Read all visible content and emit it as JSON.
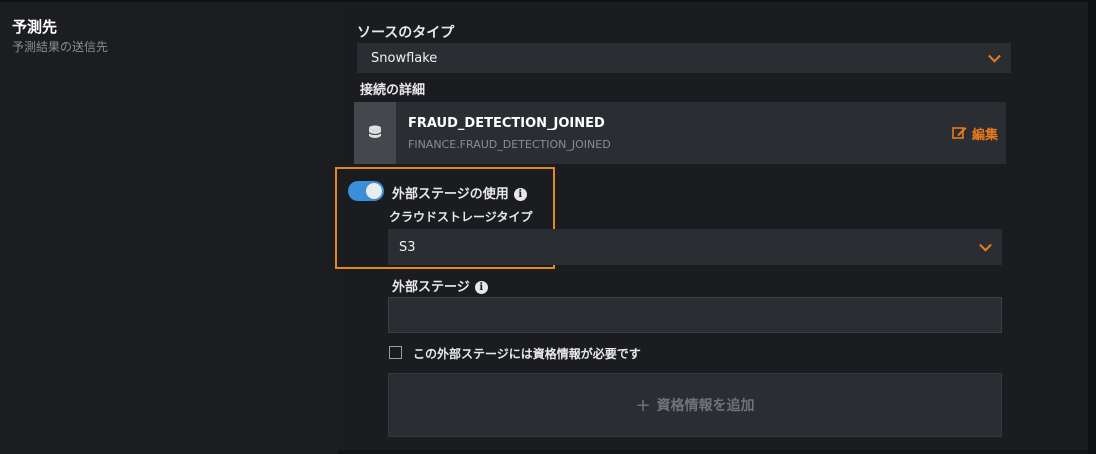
{
  "section": {
    "title": "予測先",
    "subtitle": "予測結果の送信先"
  },
  "source_type": {
    "label": "ソースのタイプ",
    "value": "Snowflake"
  },
  "connection": {
    "label": "接続の詳細",
    "name": "FRAUD_DETECTION_JOINED",
    "path": "FINANCE.FRAUD_DETECTION_JOINED",
    "edit_label": "編集"
  },
  "external_stage_toggle": {
    "label": "外部ステージの使用",
    "enabled": true
  },
  "cloud_storage": {
    "label": "クラウドストレージタイプ",
    "value": "S3"
  },
  "external_stage": {
    "label": "外部ステージ",
    "value": ""
  },
  "credentials_checkbox": {
    "label": "この外部ステージには資格情報が必要です",
    "checked": false
  },
  "add_credentials": {
    "plus": "+",
    "label": "資格情報を追加"
  },
  "colors": {
    "accent": "#e87a1e",
    "toggle_on": "#3a8fd6",
    "highlight_border": "#e08a1d"
  }
}
